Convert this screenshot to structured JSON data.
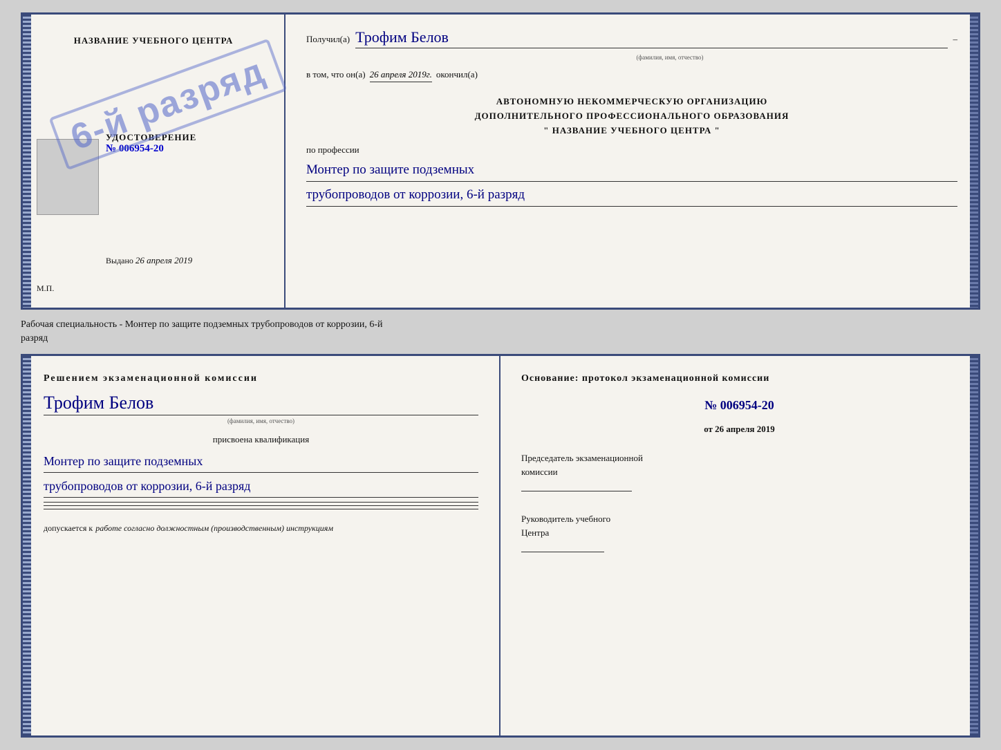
{
  "page": {
    "background": "#d0d0d0"
  },
  "between_text": {
    "line1": "Рабочая специальность - Монтер по защите подземных трубопроводов от коррозии, 6-й",
    "line2": "разряд"
  },
  "diploma_top": {
    "left": {
      "title": "НАЗВАНИЕ УЧЕБНОГО ЦЕНТРА",
      "stamp_text": "6-й разряд",
      "udostoverenie_label": "УДОСТОВЕРЕНИЕ",
      "cert_number": "№ 006954-20",
      "vydano_prefix": "Выдано",
      "vydano_date": "26 апреля 2019",
      "mp_label": "М.П."
    },
    "right": {
      "poluchil_label": "Получил(а)",
      "poluchil_name": "Трофим Белов",
      "poluchil_dash": "–",
      "fio_hint": "(фамилия, имя, отчество)",
      "vtom_prefix": "в том, что он(а)",
      "vtom_date": "26 апреля 2019г.",
      "okончил": "окончил(а)",
      "org_line1": "АВТОНОМНУЮ НЕКОММЕРЧЕСКУЮ ОРГАНИЗАЦИЮ",
      "org_line2": "ДОПОЛНИТЕЛЬНОГО ПРОФЕССИОНАЛЬНОГО ОБРАЗОВАНИЯ",
      "org_line3": "\"    НАЗВАНИЕ УЧЕБНОГО ЦЕНТРА    \"",
      "po_professii": "по профессии",
      "profession_line1": "Монтер по защите подземных",
      "profession_line2": "трубопроводов от коррозии, 6-й разряд"
    }
  },
  "diploma_bottom": {
    "left": {
      "resheniem_label": "Решением  экзаменационной  комиссии",
      "fio_name": "Трофим Белов",
      "fio_hint": "(фамилия, имя, отчество)",
      "prisvoena_label": "присвоена квалификация",
      "qualification_line1": "Монтер по защите подземных",
      "qualification_line2": "трубопроводов от коррозии, 6-й разряд",
      "dopuskaetsya_prefix": "допускается к",
      "dopuskaetsya_text": "работе согласно должностным (производственным) инструкциям"
    },
    "right": {
      "osnovaniye_label": "Основание: протокол  экзаменационной  комиссии",
      "protocol_number": "№  006954-20",
      "ot_prefix": "от",
      "ot_date": "26 апреля 2019",
      "predsedatel_label": "Председатель экзаменационной",
      "predsedatel_label2": "комиссии",
      "rukovoditel_label": "Руководитель учебного",
      "rukovoditel_label2": "Центра"
    }
  }
}
